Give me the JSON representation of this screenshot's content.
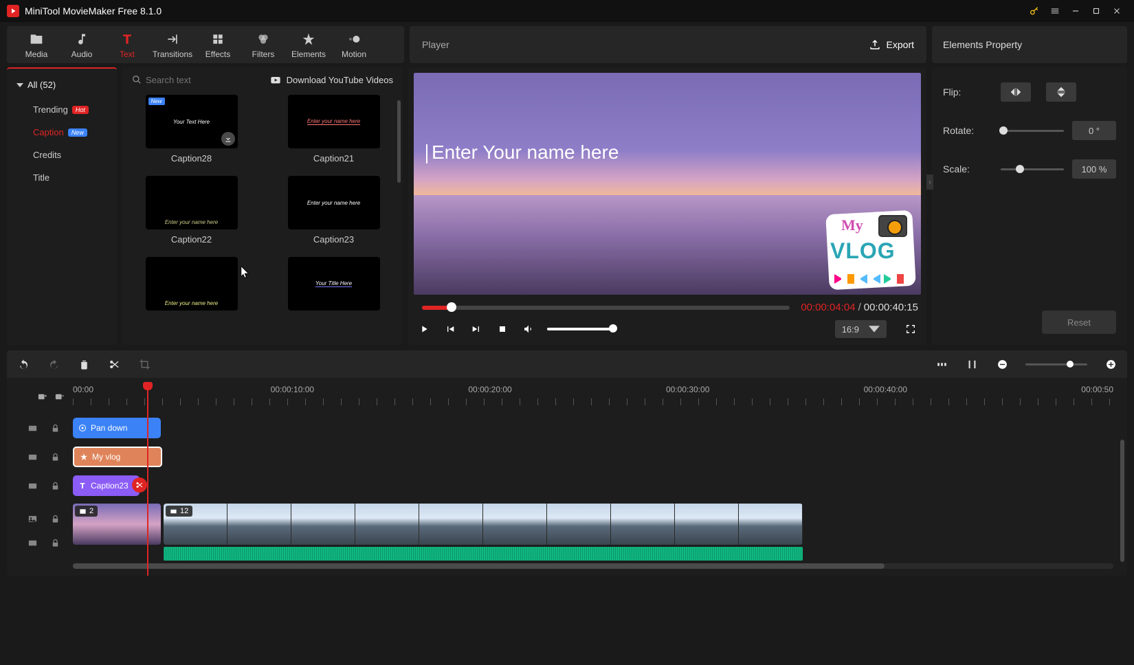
{
  "title_bar": {
    "app_title": "MiniTool MovieMaker Free 8.1.0"
  },
  "toolbar": {
    "items": [
      {
        "label": "Media"
      },
      {
        "label": "Audio"
      },
      {
        "label": "Text"
      },
      {
        "label": "Transitions"
      },
      {
        "label": "Effects"
      },
      {
        "label": "Filters"
      },
      {
        "label": "Elements"
      },
      {
        "label": "Motion"
      }
    ]
  },
  "player": {
    "title": "Player",
    "export_label": "Export",
    "current_time": "00:00:04:04",
    "total_time": "00:00:40:15",
    "aspect": "16:9",
    "caption_text": "Enter Your name here",
    "sticker_my": "My",
    "sticker_vlog": "VLOG"
  },
  "props": {
    "title": "Elements Property",
    "flip_label": "Flip:",
    "rotate_label": "Rotate:",
    "rotate_value": "0 °",
    "scale_label": "Scale:",
    "scale_value": "100 %",
    "reset_label": "Reset"
  },
  "sidebar": {
    "all_label": "All (52)",
    "items": [
      {
        "label": "Trending",
        "badge": "Hot"
      },
      {
        "label": "Caption",
        "badge": "New"
      },
      {
        "label": "Credits",
        "badge": ""
      },
      {
        "label": "Title",
        "badge": ""
      }
    ]
  },
  "gallery": {
    "search_placeholder": "Search text",
    "download_yt": "Download YouTube Videos",
    "cards": [
      {
        "label": "Caption28",
        "new": true,
        "inner": "Your Text Here",
        "dl": true
      },
      {
        "label": "Caption21",
        "new": false,
        "inner": "Enter your name here",
        "dl": false
      },
      {
        "label": "Caption22",
        "new": false,
        "inner": "Enter your name here",
        "dl": false
      },
      {
        "label": "Caption23",
        "new": false,
        "inner": "Enter your name here",
        "dl": false
      },
      {
        "label": "",
        "new": false,
        "inner": "Enter your name here",
        "dl": false
      },
      {
        "label": "",
        "new": false,
        "inner": "Your Title Here",
        "dl": false
      }
    ]
  },
  "ruler": [
    "00:00",
    "00:00:10:00",
    "00:00:20:00",
    "00:00:30:00",
    "00:00:40:00",
    "00:00:50"
  ],
  "clips": {
    "motion": "Pan down",
    "element": "My vlog",
    "caption": "Caption23",
    "v1_count": "2",
    "v2_count": "12"
  }
}
